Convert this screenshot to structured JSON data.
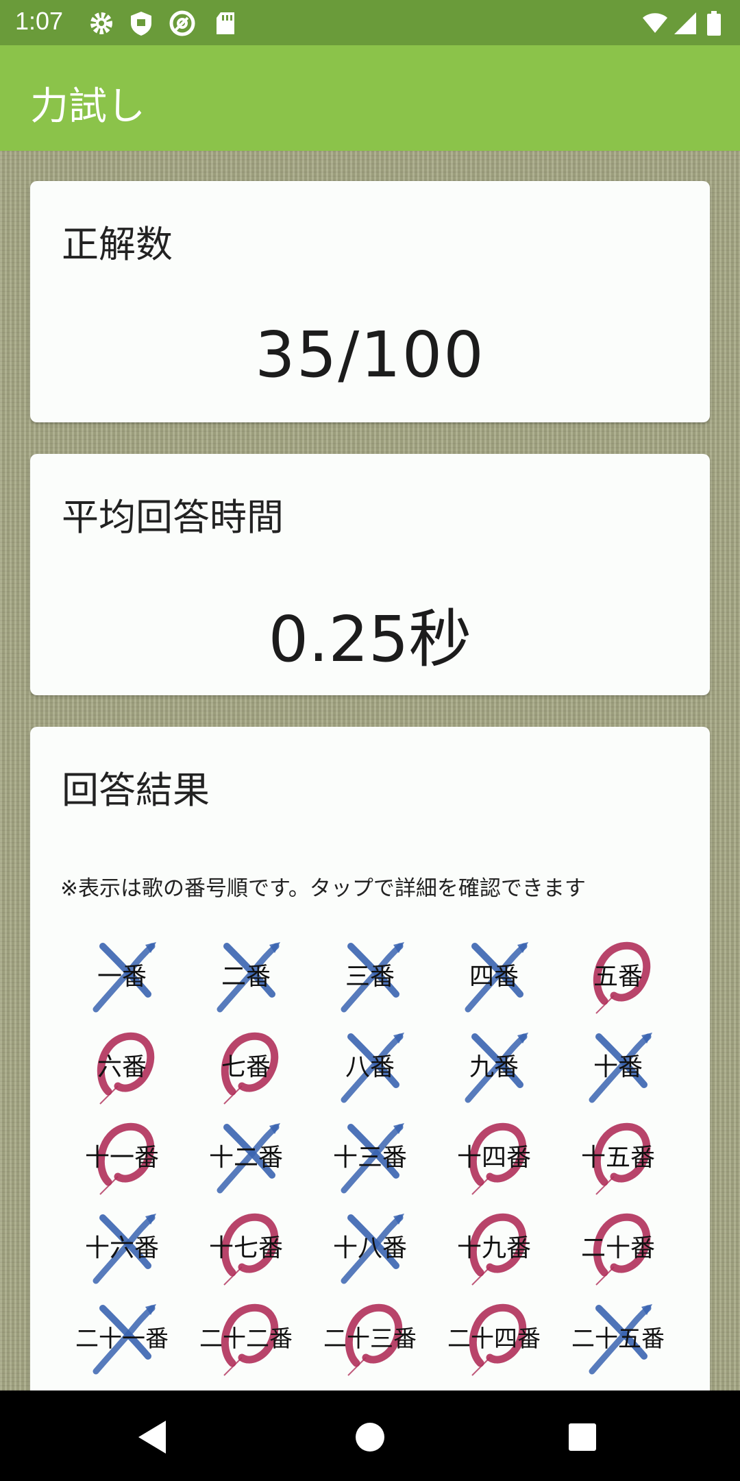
{
  "status": {
    "time": "1:07"
  },
  "app": {
    "title": "力試し"
  },
  "score": {
    "title": "正解数",
    "value": "35/100"
  },
  "avg_time": {
    "title": "平均回答時間",
    "value": "0.25秒"
  },
  "results": {
    "title": "回答結果",
    "note": "※表示は歌の番号順です。タップで詳細を確認できます",
    "items": [
      {
        "label": "一番",
        "mark": "wrong"
      },
      {
        "label": "二番",
        "mark": "wrong"
      },
      {
        "label": "三番",
        "mark": "wrong"
      },
      {
        "label": "四番",
        "mark": "wrong"
      },
      {
        "label": "五番",
        "mark": "correct"
      },
      {
        "label": "六番",
        "mark": "correct"
      },
      {
        "label": "七番",
        "mark": "correct"
      },
      {
        "label": "八番",
        "mark": "wrong"
      },
      {
        "label": "九番",
        "mark": "wrong"
      },
      {
        "label": "十番",
        "mark": "wrong"
      },
      {
        "label": "十一番",
        "mark": "correct"
      },
      {
        "label": "十二番",
        "mark": "wrong"
      },
      {
        "label": "十三番",
        "mark": "wrong"
      },
      {
        "label": "十四番",
        "mark": "correct"
      },
      {
        "label": "十五番",
        "mark": "correct"
      },
      {
        "label": "十六番",
        "mark": "wrong"
      },
      {
        "label": "十七番",
        "mark": "correct"
      },
      {
        "label": "十八番",
        "mark": "wrong"
      },
      {
        "label": "十九番",
        "mark": "correct"
      },
      {
        "label": "二十番",
        "mark": "correct"
      },
      {
        "label": "二十一番",
        "mark": "wrong"
      },
      {
        "label": "二十二番",
        "mark": "correct"
      },
      {
        "label": "二十三番",
        "mark": "correct"
      },
      {
        "label": "二十四番",
        "mark": "correct"
      },
      {
        "label": "二十五番",
        "mark": "wrong"
      }
    ]
  },
  "icons": {
    "status_left": [
      "gear-icon",
      "shield-icon",
      "at-sync-icon",
      "sd-card-icon"
    ],
    "status_right": [
      "wifi-icon",
      "signal-icon",
      "battery-icon"
    ],
    "nav": [
      "back-icon",
      "home-icon",
      "recents-icon"
    ]
  },
  "colors": {
    "status_bar": "#6a9b3a",
    "app_bar": "#8bc34a",
    "correct_mark": "#b0305a",
    "wrong_mark": "#3a64b0"
  }
}
